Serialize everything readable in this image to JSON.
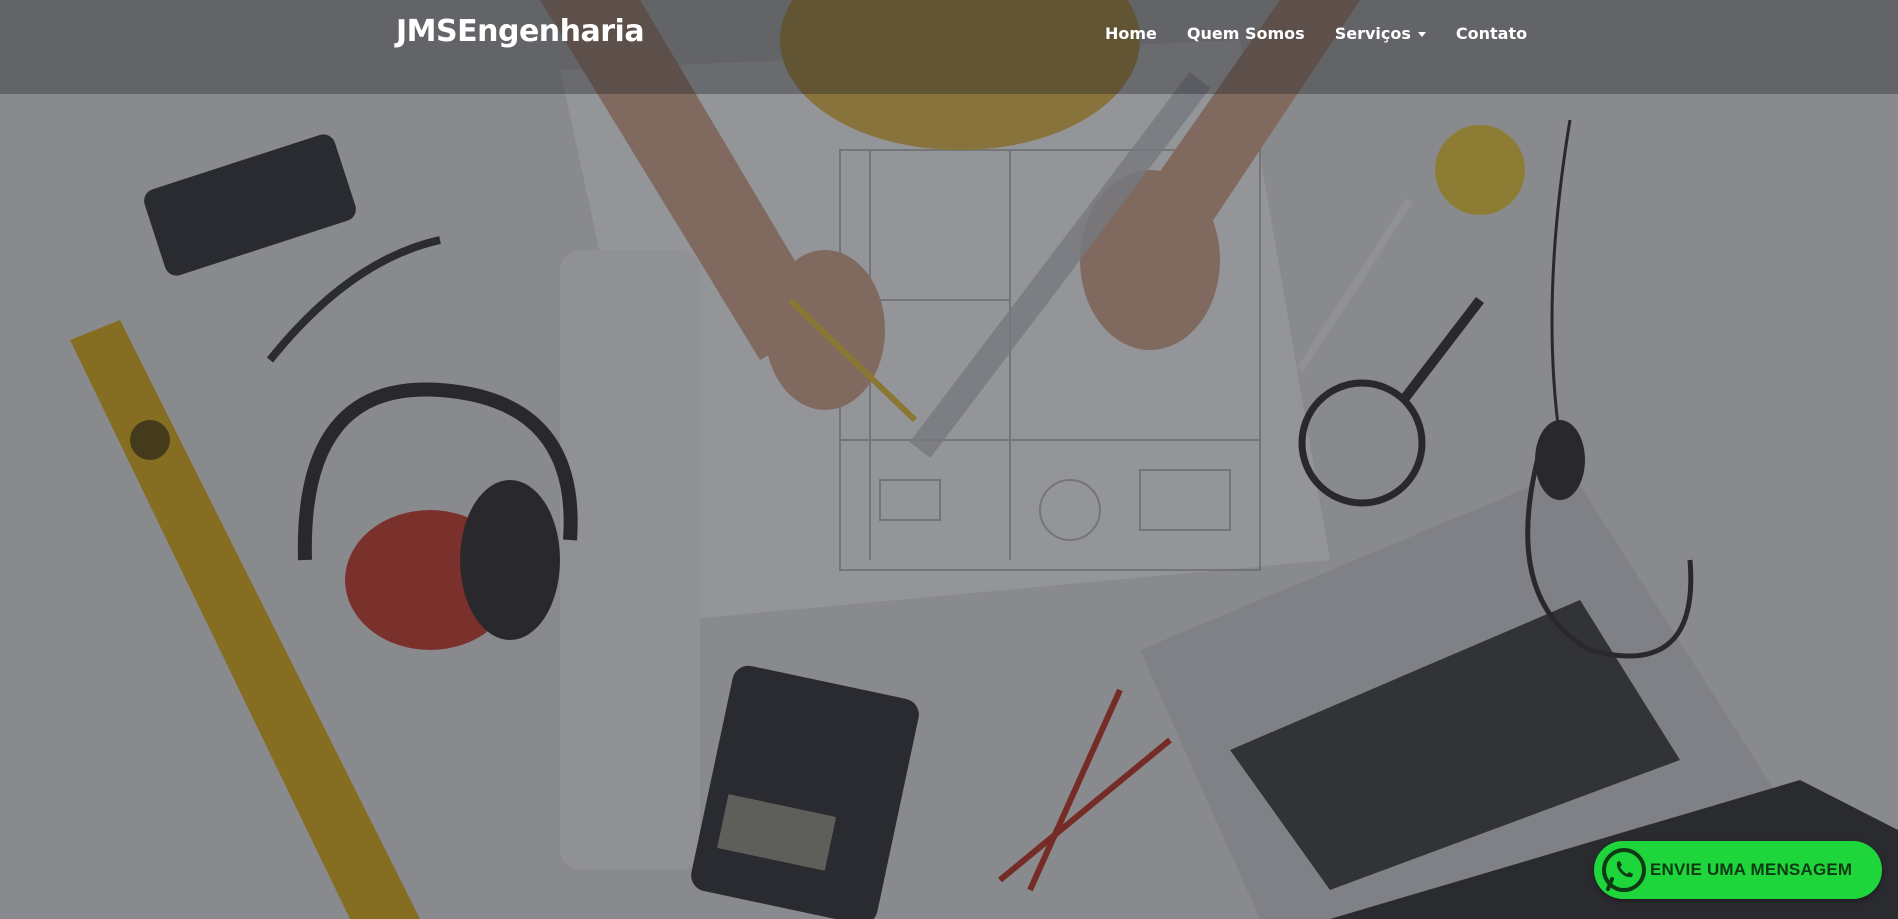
{
  "navbar": {
    "brand": "JMSEngenharia",
    "links": [
      {
        "label": "Home"
      },
      {
        "label": "Quem Somos"
      },
      {
        "label": "Serviços"
      },
      {
        "label": "Contato"
      }
    ]
  },
  "whatsapp": {
    "label": "ENVIE UMA MENSAGEM",
    "icon": "whatsapp-icon",
    "color": "#1ed63c"
  },
  "hero": {
    "background": "engineering-desk-photo"
  }
}
